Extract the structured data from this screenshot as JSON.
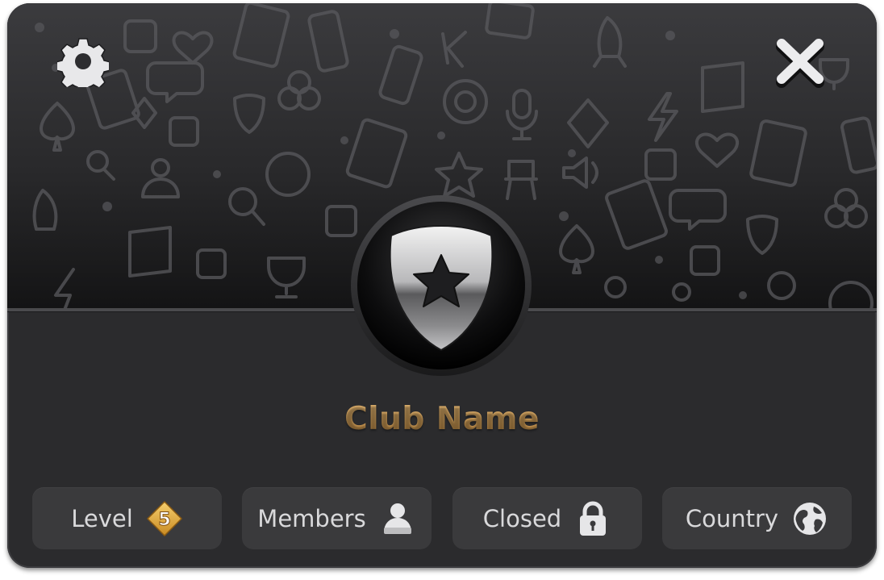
{
  "header": {
    "settings_icon": "gear-icon",
    "close_icon": "close-x-icon"
  },
  "club": {
    "name": "Club Name",
    "emblem_icon": "shield-star-icon"
  },
  "info": [
    {
      "label": "Level",
      "badge_value": "5",
      "icon": "level-diamond-icon"
    },
    {
      "label": "Members",
      "icon": "person-icon"
    },
    {
      "label": "Closed",
      "icon": "padlock-icon"
    },
    {
      "label": "Country",
      "icon": "globe-icon"
    }
  ],
  "colors": {
    "panel": "#2b2b2d",
    "pill": "#3a3a3c",
    "club_name_gold": "#c99a55",
    "level_badge": "#e0a93b"
  }
}
